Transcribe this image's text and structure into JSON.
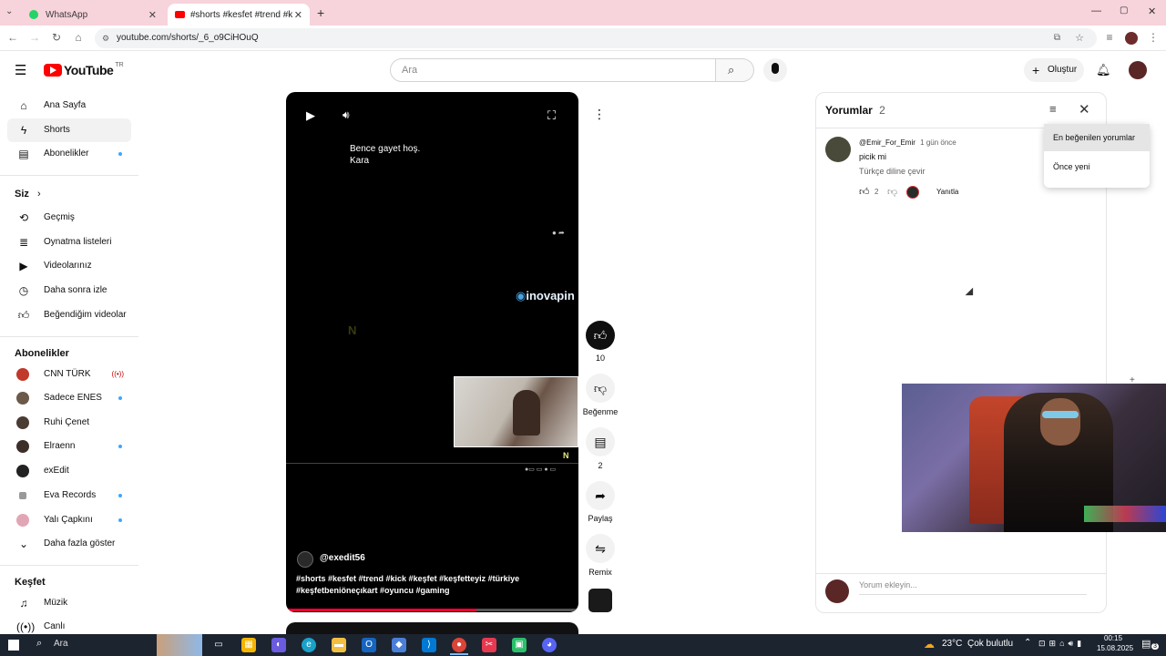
{
  "browser": {
    "tabs": [
      {
        "label": "WhatsApp",
        "active": false
      },
      {
        "label": "#shorts #kesfet #trend #kick #",
        "active": true
      }
    ],
    "new_tab": "+",
    "url": "youtube.com/shorts/_6_o9CiHOuQ"
  },
  "header": {
    "logo": "YouTube",
    "region": "TR",
    "search_placeholder": "Ara",
    "create_label": "Oluştur"
  },
  "sidebar": {
    "main": [
      {
        "label": "Ana Sayfa",
        "icon": "home-icon"
      },
      {
        "label": "Shorts",
        "icon": "shorts-icon",
        "selected": true
      },
      {
        "label": "Abonelikler",
        "icon": "subscriptions-icon",
        "dot": true
      }
    ],
    "you_title": "Siz",
    "you": [
      {
        "label": "Geçmiş",
        "icon": "history-icon"
      },
      {
        "label": "Oynatma listeleri",
        "icon": "playlist-icon"
      },
      {
        "label": "Videolarınız",
        "icon": "your-videos-icon"
      },
      {
        "label": "Daha sonra izle",
        "icon": "watch-later-icon"
      },
      {
        "label": "Beğendiğim videolar",
        "icon": "liked-videos-icon"
      }
    ],
    "subs_title": "Abonelikler",
    "subs": [
      {
        "label": "CNN TÜRK",
        "live": true,
        "color": "#c0392b"
      },
      {
        "label": "Sadece ENES",
        "dot": true,
        "color": "#6b5a4a"
      },
      {
        "label": "Ruhi Çenet",
        "dot": false,
        "color": "#4b3c33"
      },
      {
        "label": "Elraenn",
        "dot": true,
        "color": "#3c2f2a"
      },
      {
        "label": "exEdit",
        "dot": false,
        "color": "#222222"
      },
      {
        "label": "Eva Records",
        "dot": true,
        "color": "#999999"
      },
      {
        "label": "Yalı Çapkını",
        "dot": true,
        "color": "#e1a6b5"
      }
    ],
    "show_more": "Daha fazla göster",
    "explore_title": "Keşfet",
    "explore": [
      {
        "label": "Müzik",
        "icon": "music-icon"
      },
      {
        "label": "Canlı",
        "icon": "live-icon"
      }
    ]
  },
  "player": {
    "caption_line1": "Bence gayet hoş.",
    "caption_line2": "Kara",
    "watermark": "inovapin",
    "channel": "@exedit56",
    "hashtags_line1": "#shorts #kesfet #trend #kick #keşfet #keşfetteyiz #türkiye",
    "hashtags_line2": "#keşfetbeniöneçıkart #oyuncu #gaming",
    "progress_fraction": 0.65
  },
  "actions": {
    "like_count": "10",
    "dislike_label": "Beğenme",
    "comments_count": "2",
    "share_label": "Paylaş",
    "remix_label": "Remix"
  },
  "comments": {
    "title": "Yorumlar",
    "count": "2",
    "items": [
      {
        "author": "@Emir_For_Emir",
        "time": "1 gün önce",
        "text": "picik mi",
        "translate": "Türkçe diline çevir",
        "likes": "2",
        "reply": "Yanıtla"
      }
    ],
    "add_placeholder": "Yorum ekleyin...",
    "sort_options": [
      {
        "label": "En beğenilen yorumlar",
        "selected": true
      },
      {
        "label": "Önce yeni",
        "selected": false
      }
    ]
  },
  "taskbar": {
    "search": "Ara",
    "weather_temp": "23°C",
    "weather_desc": "Çok bulutlu",
    "time": "00:15",
    "date": "15.08.2025",
    "notif_count": "3"
  },
  "colors": {
    "tabstrip": "#f7d3dc",
    "yt_red": "#ff0000",
    "accent_blue": "#3ea6ff",
    "taskbar": "#1c2430"
  }
}
